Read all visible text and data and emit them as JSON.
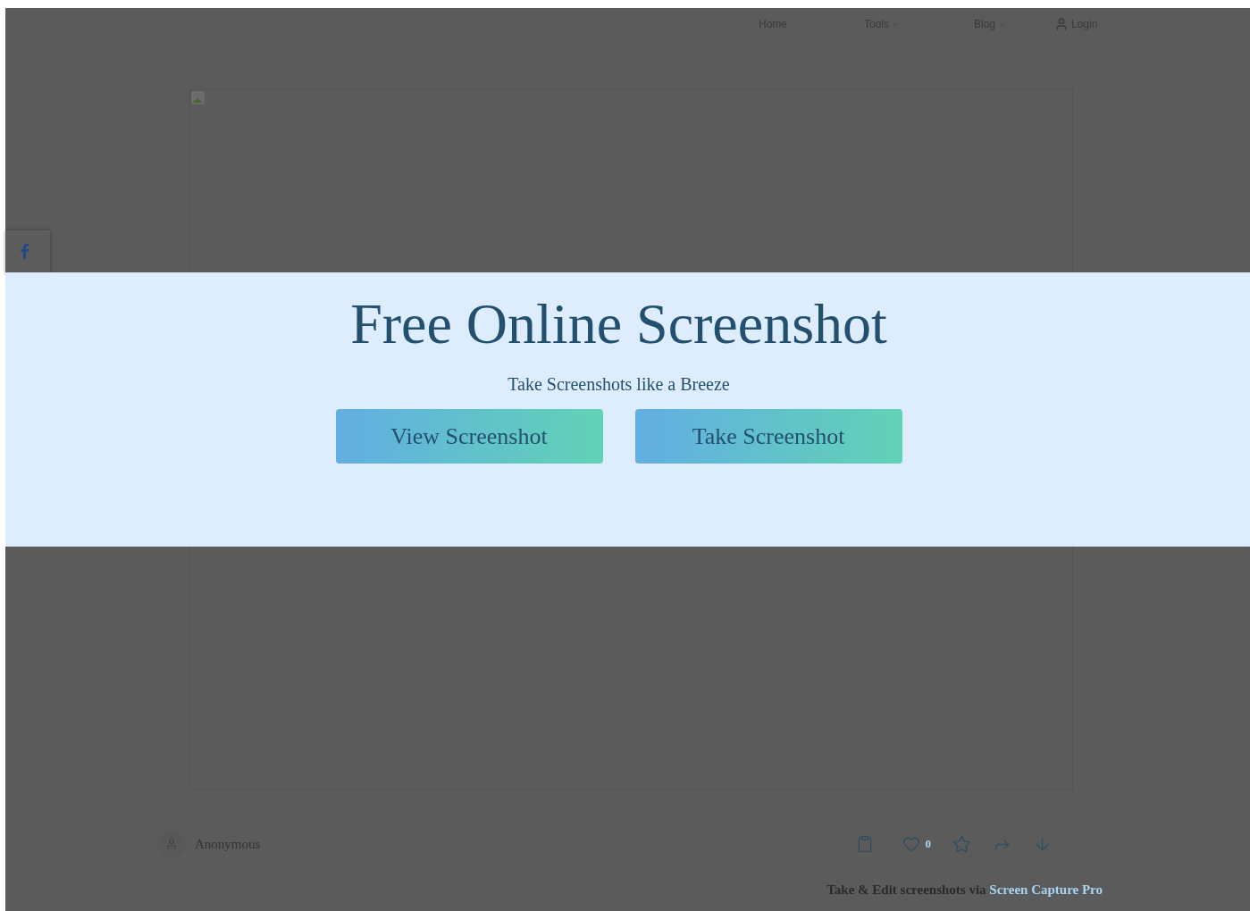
{
  "nav": {
    "items": [
      {
        "label": "Home",
        "kind": "link"
      },
      {
        "label": "Tools",
        "kind": "dropdown"
      },
      {
        "label": "Blog",
        "kind": "dropdown"
      },
      {
        "label": "Login",
        "kind": "login"
      }
    ]
  },
  "banner": {
    "title": "Free Online Screenshot",
    "subtitle": "Take Screenshots like a Breeze",
    "buttons": [
      "View Screenshot",
      "Take Screenshot"
    ]
  },
  "footer": {
    "author": "Anonymous",
    "likes": "0",
    "credit": "Take & Edit screenshots via",
    "credit_link": "Screen Capture Pro"
  }
}
